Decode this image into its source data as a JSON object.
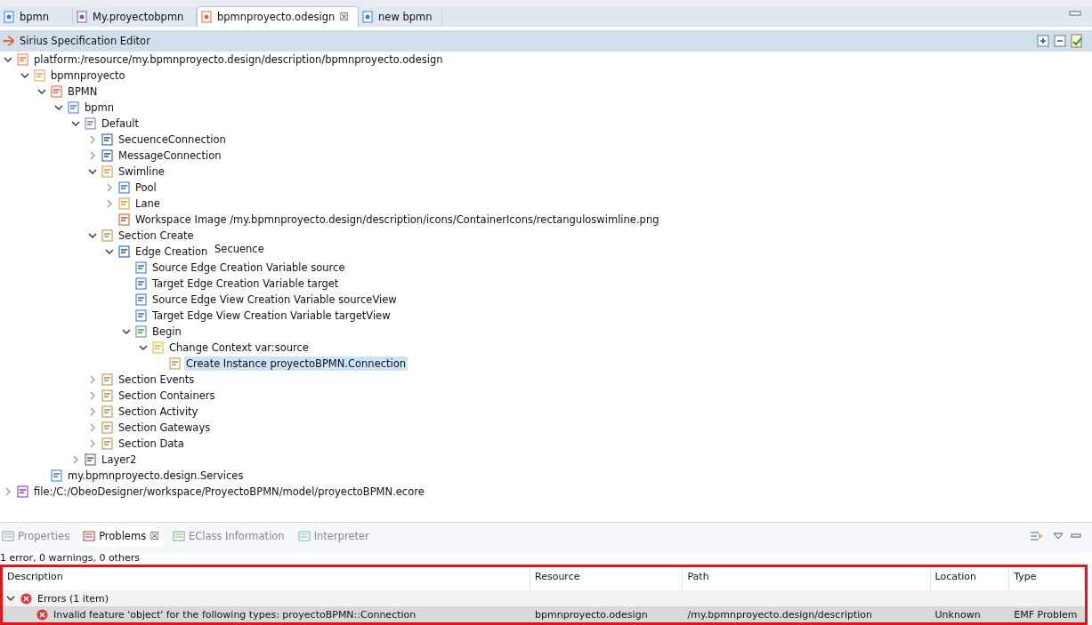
{
  "editor_tabs": [
    {
      "label": "bpmn",
      "kind": "diagram",
      "selected": false
    },
    {
      "label": "My.proyectobpmn",
      "kind": "model",
      "selected": false
    },
    {
      "label": "bpmnproyecto.odesign",
      "kind": "odesign",
      "selected": true,
      "close": "☒"
    },
    {
      "label": "new bpmn",
      "kind": "tree",
      "selected": false
    }
  ],
  "editor": {
    "title": "Sirius Specification Editor"
  },
  "tree": [
    {
      "label": "platform:/resource/my.bpmnproyecto.design/description/bpmnproyecto.odesign",
      "kind": "file",
      "expanded": true,
      "selected": false,
      "children": [
        {
          "label": "bpmnproyecto",
          "kind": "group",
          "expanded": true,
          "selected": false,
          "children": [
            {
              "label": "BPMN",
              "kind": "viewpoint",
              "expanded": true,
              "selected": false,
              "children": [
                {
                  "label": "bpmn",
                  "kind": "diagram",
                  "expanded": true,
                  "selected": false,
                  "children": [
                    {
                      "label": "Default",
                      "kind": "layer",
                      "expanded": true,
                      "selected": false,
                      "children": [
                        {
                          "label": "SecuenceConnection",
                          "kind": "edge",
                          "expanded": false,
                          "selected": false
                        },
                        {
                          "label": "MessageConnection",
                          "kind": "edge",
                          "expanded": false,
                          "selected": false
                        },
                        {
                          "label": "Swimline",
                          "kind": "container",
                          "expanded": true,
                          "selected": false,
                          "children": [
                            {
                              "label": "Pool",
                              "kind": "node",
                              "expanded": false,
                              "selected": false
                            },
                            {
                              "label": "Lane",
                              "kind": "container",
                              "expanded": false,
                              "selected": false
                            },
                            {
                              "label": "Workspace Image /my.bpmnproyecto.design/description/icons/ContainerIcons/rectanguloswimline.png",
                              "kind": "image",
                              "selected": false
                            }
                          ]
                        },
                        {
                          "label": "Section Create",
                          "kind": "section",
                          "expanded": true,
                          "selected": false,
                          "children": [
                            {
                              "label": "Edge Creation",
                              "kind": "tool",
                              "expanded": true,
                              "selected": false,
                              "tooltip": "Secuence",
                              "children": [
                                {
                                  "label": "Source Edge Creation Variable source",
                                  "kind": "variable",
                                  "selected": false
                                },
                                {
                                  "label": "Target Edge Creation Variable target",
                                  "kind": "variable",
                                  "selected": false
                                },
                                {
                                  "label": "Source Edge View Creation Variable sourceView",
                                  "kind": "variable",
                                  "selected": false
                                },
                                {
                                  "label": "Target Edge View Creation Variable targetView",
                                  "kind": "variable",
                                  "selected": false
                                },
                                {
                                  "label": "Begin",
                                  "kind": "begin",
                                  "expanded": true,
                                  "selected": false,
                                  "children": [
                                    {
                                      "label": "Change Context var:source",
                                      "kind": "context",
                                      "expanded": true,
                                      "selected": false,
                                      "children": [
                                        {
                                          "label": "Create Instance proyectoBPMN.Connection",
                                          "kind": "create",
                                          "selected": true
                                        }
                                      ]
                                    }
                                  ]
                                }
                              ]
                            }
                          ]
                        },
                        {
                          "label": "Section Events",
                          "kind": "section",
                          "expanded": false,
                          "selected": false
                        },
                        {
                          "label": "Section Containers",
                          "kind": "section",
                          "expanded": false,
                          "selected": false
                        },
                        {
                          "label": "Section Activity",
                          "kind": "section",
                          "expanded": false,
                          "selected": false
                        },
                        {
                          "label": "Section Gateways",
                          "kind": "section",
                          "expanded": false,
                          "selected": false
                        },
                        {
                          "label": "Section Data",
                          "kind": "section",
                          "expanded": false,
                          "selected": false
                        }
                      ]
                    },
                    {
                      "label": "Layer2",
                      "kind": "layer2",
                      "expanded": false,
                      "selected": false
                    }
                  ]
                }
              ]
            },
            {
              "label": "my.bpmnproyecto.design.Services",
              "kind": "java",
              "selected": false
            }
          ]
        }
      ]
    },
    {
      "label": "file:/C:/ObeoDesigner/workspace/ProyectoBPMN/model/proyectoBPMN.ecore",
      "kind": "ecore",
      "expanded": false,
      "selected": false
    }
  ],
  "bottom_tabs": [
    {
      "label": "Properties",
      "kind": "properties",
      "selected": false
    },
    {
      "label": "Problems",
      "kind": "problems",
      "selected": true,
      "close": "☒"
    },
    {
      "label": "EClass Information",
      "kind": "eclass",
      "selected": false
    },
    {
      "label": "Interpreter",
      "kind": "interpreter",
      "selected": false
    }
  ],
  "problems": {
    "summary": "1 error, 0 warnings, 0 others",
    "columns": [
      "Description",
      "Resource",
      "Path",
      "Location",
      "Type"
    ],
    "groups": [
      {
        "label": "Errors (1 item)",
        "expanded": true,
        "rows": [
          {
            "cells": [
              "Invalid feature 'object' for the following types: proyectoBPMN::Connection",
              "bpmnproyecto.odesign",
              "/my.bpmnproyecto.design/description",
              "Unknown",
              "EMF Problem"
            ],
            "selected": true
          }
        ]
      }
    ]
  }
}
